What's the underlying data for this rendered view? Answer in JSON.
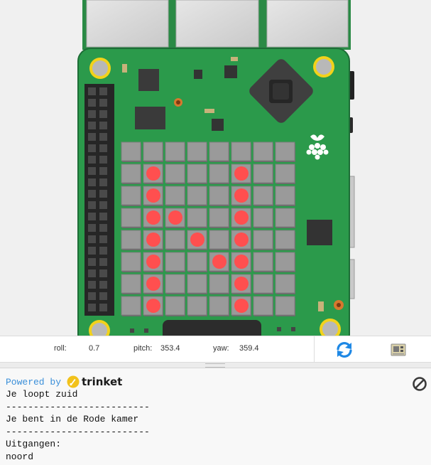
{
  "status": {
    "roll_label": "roll:",
    "roll_value": "0.7",
    "pitch_label": "pitch:",
    "pitch_value": "353.4",
    "yaw_label": "yaw:",
    "yaw_value": "359.4"
  },
  "buttons": {
    "refresh_icon": "refresh-icon",
    "board_icon": "board-icon",
    "clear_icon": "clear-output-icon"
  },
  "console": {
    "powered_by": "Powered by",
    "brand": "trinket",
    "lines": [
      "Je loopt zuid",
      "--------------------------",
      "Je bent in de Rode kamer",
      "--------------------------",
      "Uitgangen:",
      "noord"
    ]
  },
  "colors": {
    "board_green": "#2e9e4e",
    "led_on": "#ff4f4f",
    "led_off": "#8c8c8c",
    "accent_blue": "#1e88e5"
  },
  "led_matrix": [
    [
      0,
      0,
      0,
      0,
      0,
      0,
      0,
      0
    ],
    [
      0,
      1,
      0,
      0,
      0,
      1,
      0,
      0
    ],
    [
      0,
      1,
      0,
      0,
      0,
      1,
      0,
      0
    ],
    [
      0,
      1,
      1,
      0,
      0,
      1,
      0,
      0
    ],
    [
      0,
      1,
      0,
      1,
      0,
      1,
      0,
      0
    ],
    [
      0,
      1,
      0,
      0,
      1,
      1,
      0,
      0
    ],
    [
      0,
      1,
      0,
      0,
      0,
      1,
      0,
      0
    ],
    [
      0,
      1,
      0,
      0,
      0,
      1,
      0,
      0
    ]
  ]
}
